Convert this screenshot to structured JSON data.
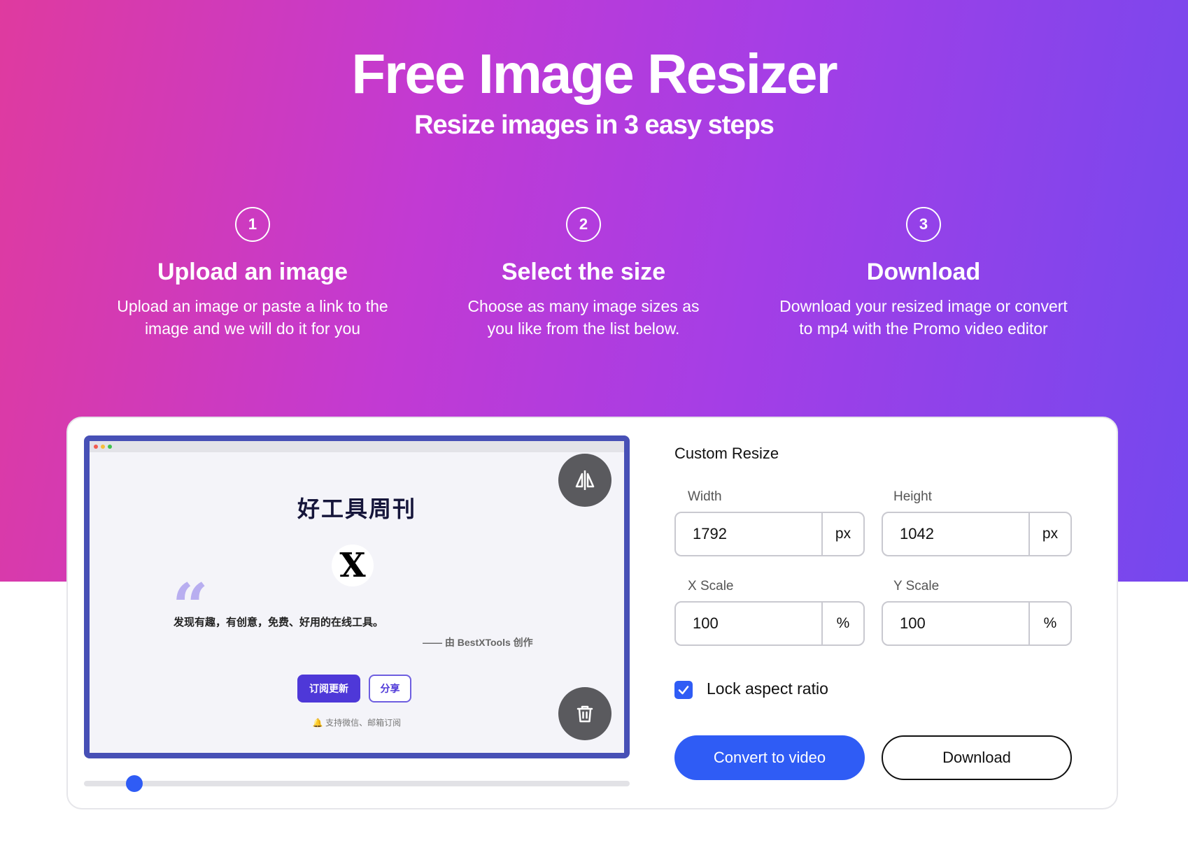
{
  "hero": {
    "title": "Free Image Resizer",
    "subtitle": "Resize images in 3 easy steps"
  },
  "steps": [
    {
      "number": "1",
      "title": "Upload an image",
      "desc_line1": "Upload an image or paste a link to the",
      "desc_line2": "image and we will do it for you"
    },
    {
      "number": "2",
      "title": "Select the size",
      "desc_line1": "Choose as many image sizes as",
      "desc_line2": "you like from the list below."
    },
    {
      "number": "3",
      "title": "Download",
      "desc_line1": "Download your resized image or convert",
      "desc_line2": "to mp4 with the Promo video editor"
    }
  ],
  "preview": {
    "site_title": "好工具周刊",
    "logo_letter": "X",
    "quote_mark": "“",
    "tagline": "发现有趣，有创意，免费、好用的在线工具。",
    "credit": "—— 由 BestXTools 创作",
    "subscribe_label": "订阅更新",
    "share_label": "分享",
    "note": "支持微信、邮箱订阅",
    "slider_value": 0.08
  },
  "panel": {
    "title": "Custom Resize",
    "width_label": "Width",
    "width_value": "1792",
    "width_unit": "px",
    "height_label": "Height",
    "height_value": "1042",
    "height_unit": "px",
    "xscale_label": "X Scale",
    "xscale_value": "100",
    "xscale_unit": "%",
    "yscale_label": "Y Scale",
    "yscale_value": "100",
    "yscale_unit": "%",
    "lock_label": "Lock aspect ratio",
    "lock_checked": true,
    "convert_label": "Convert to video",
    "download_label": "Download"
  },
  "colors": {
    "accent": "#2f5cf5",
    "gradient_start": "#df3a9f",
    "gradient_end": "#7448ee",
    "preview_frame": "#4750b6"
  }
}
